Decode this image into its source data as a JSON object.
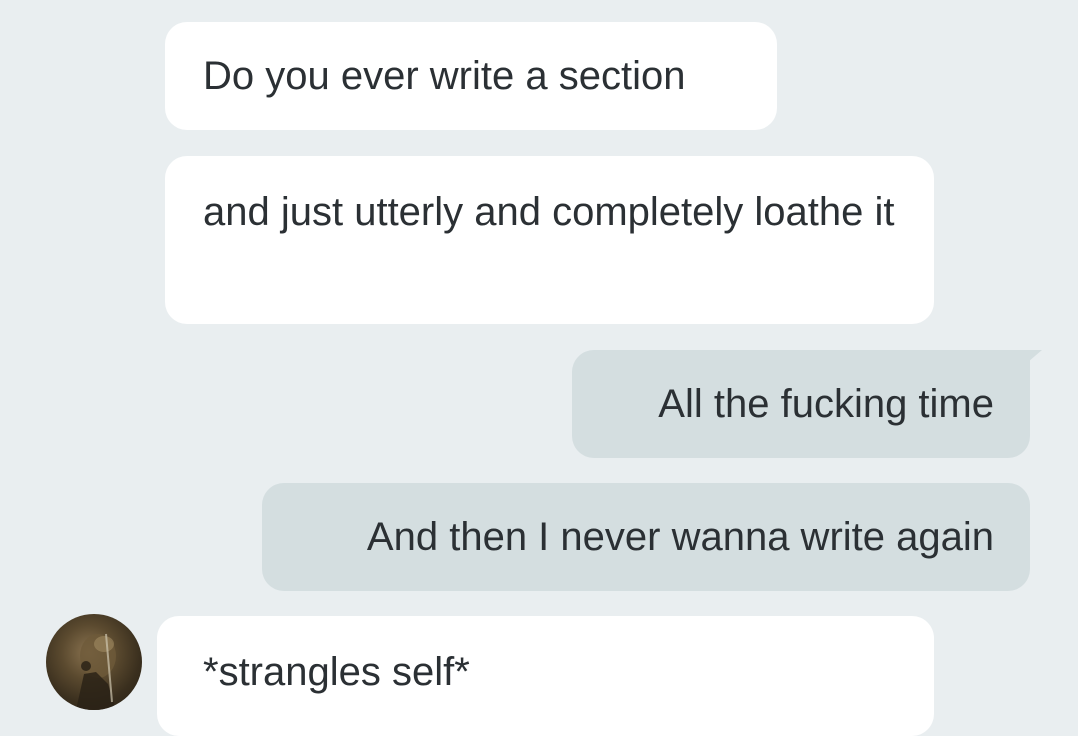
{
  "messages": [
    {
      "direction": "incoming",
      "text": "Do you ever write a section"
    },
    {
      "direction": "incoming",
      "text": "and just utterly and completely loathe it"
    },
    {
      "direction": "outgoing",
      "text": "All the fucking time"
    },
    {
      "direction": "outgoing",
      "text": "And then I never wanna write again"
    },
    {
      "direction": "incoming",
      "text": "*strangles self*"
    }
  ],
  "colors": {
    "background": "#e9eef0",
    "incoming_bubble": "#ffffff",
    "outgoing_bubble": "#d4dee0",
    "text": "#2b3034"
  },
  "icons": {
    "avatar": "contact-avatar-photo"
  }
}
